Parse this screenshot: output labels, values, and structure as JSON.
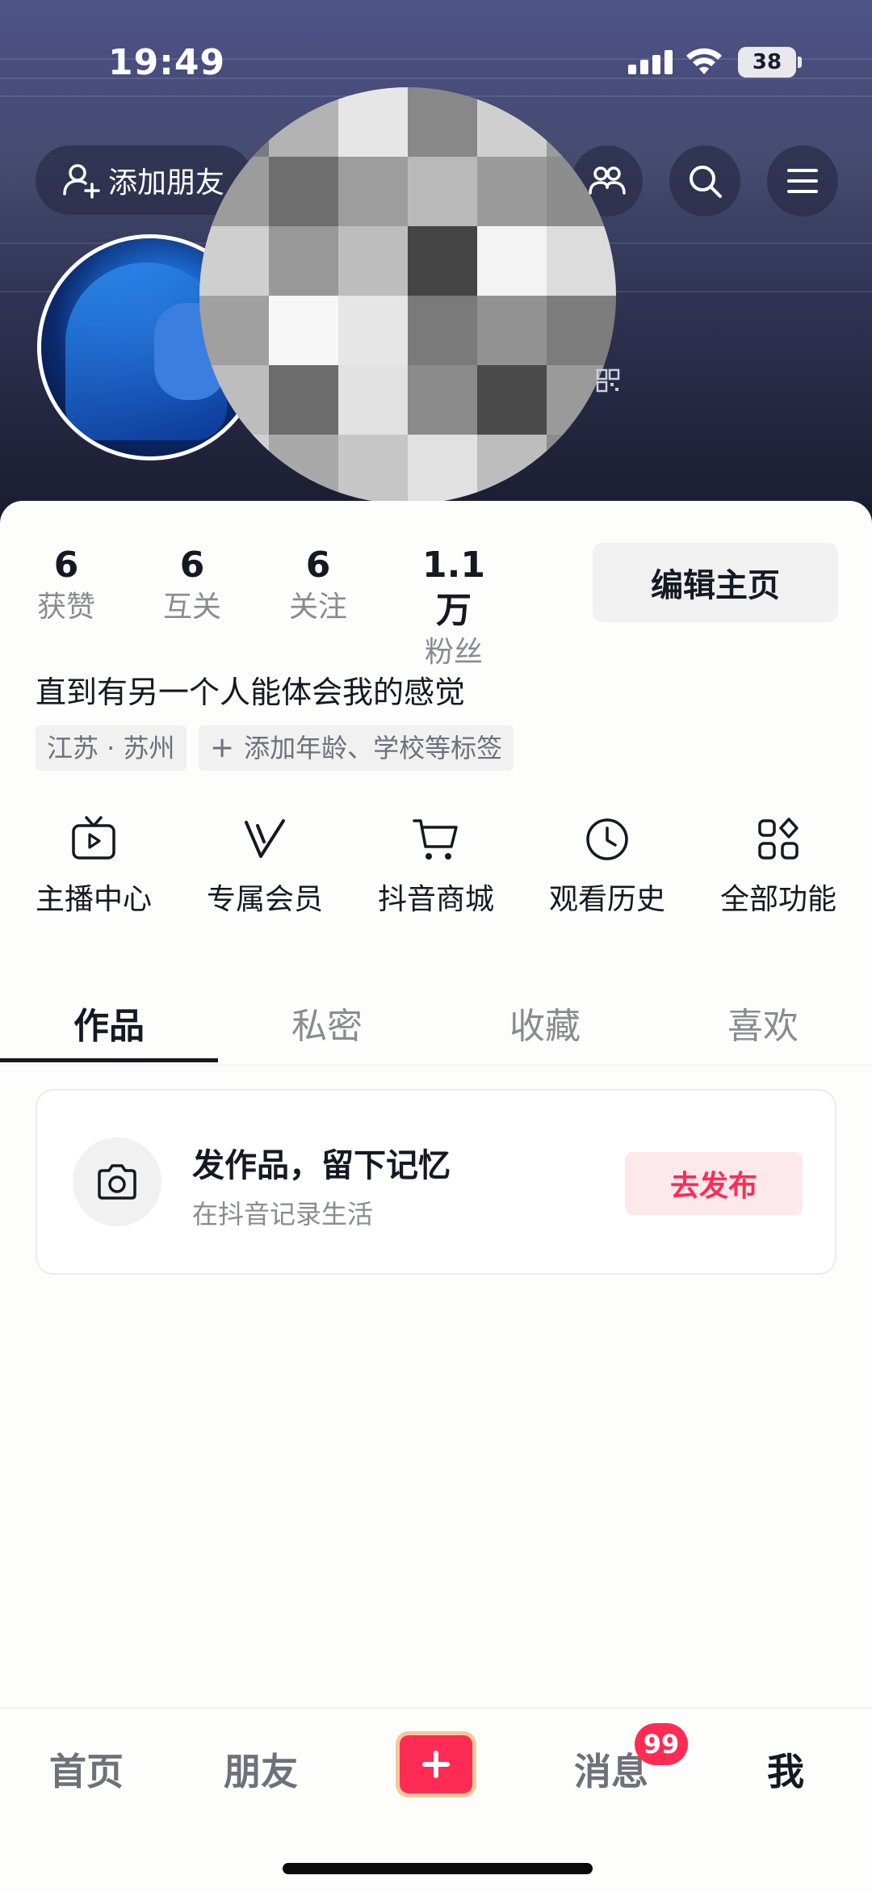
{
  "status_bar": {
    "time": "19:49",
    "battery": "38"
  },
  "top_bar": {
    "add_friend_label": "添加朋友"
  },
  "stats": [
    {
      "value": "6",
      "label": "获赞"
    },
    {
      "value": "6",
      "label": "互关"
    },
    {
      "value": "6",
      "label": "关注"
    },
    {
      "value": "1.1万",
      "label": "粉丝"
    }
  ],
  "edit_profile_label": "编辑主页",
  "bio": "直到有另一个人能体会我的感觉",
  "tags": {
    "location": "江苏 · 苏州",
    "add_tag": "添加年龄、学校等标签"
  },
  "features": [
    {
      "label": "主播中心",
      "icon": "tv-play-icon"
    },
    {
      "label": "专属会员",
      "icon": "v-icon"
    },
    {
      "label": "抖音商城",
      "icon": "cart-icon"
    },
    {
      "label": "观看历史",
      "icon": "clock-icon"
    },
    {
      "label": "全部功能",
      "icon": "grid-icon"
    }
  ],
  "tabs": [
    "作品",
    "私密",
    "收藏",
    "喜欢"
  ],
  "publish_card": {
    "title": "发作品，留下记忆",
    "subtitle": "在抖音记录生活",
    "button": "去发布"
  },
  "bottom_nav": {
    "home": "首页",
    "friends": "朋友",
    "messages": "消息",
    "me": "我",
    "messages_badge": "99"
  },
  "colors": {
    "accent": "#fe2c55",
    "text": "#161823",
    "muted": "#8a8b91"
  }
}
